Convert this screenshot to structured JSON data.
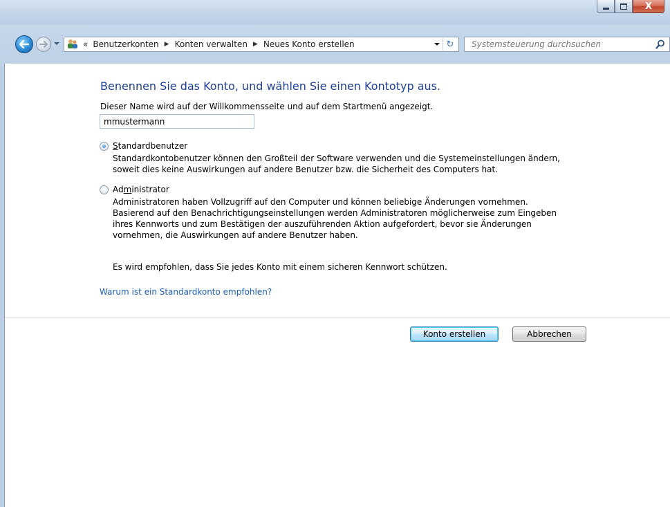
{
  "window": {
    "minimize_icon": "minimize-icon",
    "maximize_icon": "maximize-icon",
    "close_glyph": "X"
  },
  "nav": {
    "back_icon": "arrow-left-icon",
    "forward_icon": "arrow-right-icon",
    "breadcrumb_prefix": "«",
    "breadcrumbs": [
      "Benutzerkonten",
      "Konten verwalten",
      "Neues Konto erstellen"
    ],
    "separator": "▶",
    "refresh_glyph": "↻",
    "search_placeholder": "Systemsteuerung durchsuchen"
  },
  "main": {
    "heading": "Benennen Sie das Konto, und wählen Sie einen Kontotyp aus.",
    "description": "Dieser Name wird auf der Willkommensseite und auf dem Startmenü angezeigt.",
    "name_value": "mmustermann",
    "options": [
      {
        "label_access": "S",
        "label_rest": "tandardbenutzer",
        "selected": true,
        "lines": [
          "Standardkontobenutzer können den Großteil der Software verwenden und die Systemeinstellungen ändern,",
          "soweit dies keine Auswirkungen auf andere Benutzer bzw. die Sicherheit des Computers hat."
        ]
      },
      {
        "label_pre": "Ad",
        "label_access": "m",
        "label_rest": "inistrator",
        "selected": false,
        "lines": [
          "Administratoren haben Vollzugriff auf den Computer und können beliebige Änderungen vornehmen.",
          "Basierend auf den Benachrichtigungseinstellungen werden Administratoren möglicherweise zum Eingeben",
          "ihres Kennworts und zum Bestätigen der auszuführenden Aktion aufgefordert, bevor sie Änderungen",
          "vornehmen, die Auswirkungen auf andere Benutzer haben."
        ]
      }
    ],
    "recommendation": "Es wird empfohlen, dass Sie jedes Konto mit einem sicheren Kennwort schützen.",
    "why_link": "Warum ist ein Standardkonto empfohlen?",
    "create_button": "Konto erstellen",
    "cancel_button": "Abbrechen"
  }
}
